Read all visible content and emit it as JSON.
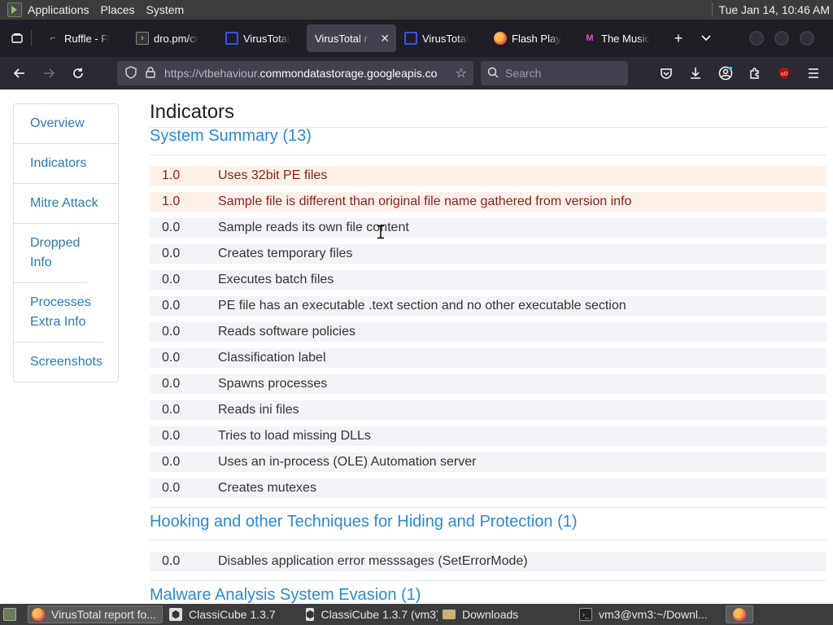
{
  "top_panel": {
    "menus": [
      "Applications",
      "Places",
      "System"
    ],
    "clock": "Tue Jan 14, 10:46 AM"
  },
  "tabs": [
    {
      "label": "Ruffle - Fl",
      "active": false
    },
    {
      "label": "dro.pm/cr",
      "active": false
    },
    {
      "label": "VirusTotal",
      "active": false
    },
    {
      "label": "VirusTotal r",
      "active": true
    },
    {
      "label": "VirusTotal",
      "active": false
    },
    {
      "label": "Flash Play",
      "active": false
    },
    {
      "label": "The Music",
      "active": false
    }
  ],
  "navbar": {
    "url_prefix": "https://vtbehaviour.",
    "url_host": "commondatastorage.googleapis.co",
    "search_placeholder": "Search"
  },
  "sidebar": {
    "items": [
      {
        "label": "Overview"
      },
      {
        "label": "Indicators"
      },
      {
        "label": "Mitre Attack"
      },
      {
        "label": "Dropped Info"
      },
      {
        "label": "Processes Extra Info"
      },
      {
        "label": "Screenshots"
      }
    ]
  },
  "main": {
    "heading": "Indicators",
    "sections": [
      {
        "title": "System Summary (13)",
        "rows": [
          {
            "score": "1.0",
            "text": "Uses 32bit PE files",
            "highlight": true
          },
          {
            "score": "1.0",
            "text": "Sample file is different than original file name gathered from version info",
            "highlight": true
          },
          {
            "score": "0.0",
            "text": "Sample reads its own file content",
            "highlight": false
          },
          {
            "score": "0.0",
            "text": "Creates temporary files",
            "highlight": false
          },
          {
            "score": "0.0",
            "text": "Executes batch files",
            "highlight": false
          },
          {
            "score": "0.0",
            "text": "PE file has an executable .text section and no other executable section",
            "highlight": false
          },
          {
            "score": "0.0",
            "text": "Reads software policies",
            "highlight": false
          },
          {
            "score": "0.0",
            "text": "Classification label",
            "highlight": false
          },
          {
            "score": "0.0",
            "text": "Spawns processes",
            "highlight": false
          },
          {
            "score": "0.0",
            "text": "Reads ini files",
            "highlight": false
          },
          {
            "score": "0.0",
            "text": "Tries to load missing DLLs",
            "highlight": false
          },
          {
            "score": "0.0",
            "text": "Uses an in-process (OLE) Automation server",
            "highlight": false
          },
          {
            "score": "0.0",
            "text": "Creates mutexes",
            "highlight": false
          }
        ]
      },
      {
        "title": "Hooking and other Techniques for Hiding and Protection (1)",
        "rows": [
          {
            "score": "0.0",
            "text": "Disables application error messsages (SetErrorMode)",
            "highlight": false
          }
        ]
      },
      {
        "title": "Malware Analysis System Evasion (1)",
        "rows": []
      }
    ]
  },
  "taskbar": {
    "items": [
      {
        "label": "VirusTotal report fo...",
        "active": true
      },
      {
        "label": "ClassiCube 1.3.7",
        "active": false
      },
      {
        "label": "ClassiCube 1.3.7 (vm3)",
        "active": false
      },
      {
        "label": "Downloads",
        "active": false
      },
      {
        "label": "vm3@vm3:~/Downl...",
        "active": false
      }
    ]
  }
}
